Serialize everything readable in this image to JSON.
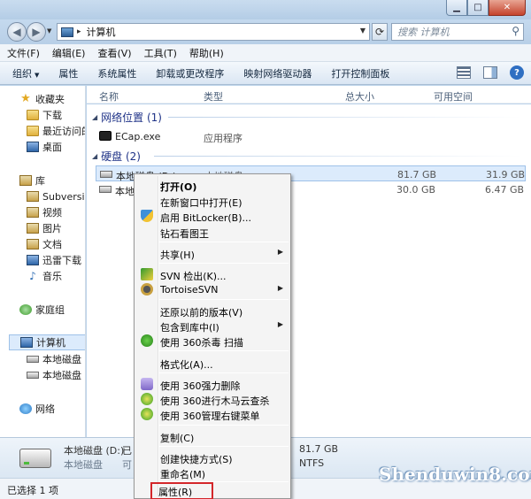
{
  "address": {
    "crumb": "计算机",
    "separator": "▸"
  },
  "search": {
    "placeholder": "搜索 计算机"
  },
  "menubar": [
    "文件(F)",
    "编辑(E)",
    "查看(V)",
    "工具(T)",
    "帮助(H)"
  ],
  "toolbar": {
    "organize": "组织",
    "properties": "属性",
    "system_properties": "系统属性",
    "uninstall": "卸载或更改程序",
    "map_drive": "映射网络驱动器",
    "control_panel": "打开控制面板"
  },
  "nav": {
    "favorites": "收藏夹",
    "downloads": "下载",
    "recent": "最近访问的",
    "desktop": "桌面",
    "libraries": "库",
    "subversion": "Subversion",
    "videos": "视频",
    "pictures": "图片",
    "documents": "文档",
    "thunder": "迅雷下载",
    "music": "音乐",
    "homegroup": "家庭组",
    "computer": "计算机",
    "local_c": "本地磁盘 (C",
    "local_d": "本地磁盘 (D",
    "network": "网络"
  },
  "columns": {
    "name": "名称",
    "type": "类型",
    "total": "总大小",
    "free": "可用空间"
  },
  "groups": {
    "network_location": "网络位置 (1)",
    "hard_disks": "硬盘 (2)"
  },
  "rows": {
    "ecap": {
      "name": "ECap.exe",
      "type": "应用程序"
    },
    "drive_d": {
      "name": "本地磁盘 (D:)",
      "type": "本地磁盘",
      "total": "81.7 GB",
      "free": "31.9 GB"
    },
    "drive_c": {
      "name": "本地磁",
      "total": "30.0 GB",
      "free": "6.47 GB"
    }
  },
  "details": {
    "name": "本地磁盘 (D:)",
    "name_suffix": "已",
    "type": "本地磁盘",
    "avail_label": "可",
    "total": "81.7 GB",
    "fs": "NTFS"
  },
  "status": {
    "selected": "已选择 1 项"
  },
  "context_menu": {
    "open": "打开(O)",
    "open_new_window": "在新窗口中打开(E)",
    "bitlocker": "启用 BitLocker(B)...",
    "diamond": "钻石看图王",
    "share": "共享(H)",
    "svn_checkout": "SVN 检出(K)...",
    "tortoise": "TortoiseSVN",
    "restore": "还原以前的版本(V)",
    "include_library": "包含到库中(I)",
    "scan360": "使用 360杀毒 扫描",
    "format": "格式化(A)...",
    "force_delete": "使用 360强力删除",
    "trojan_cloud": "使用 360进行木马云查杀",
    "manage_menu": "使用 360管理右键菜单",
    "copy": "复制(C)",
    "shortcut": "创建快捷方式(S)",
    "rename": "重命名(M)",
    "properties": "属性(R)"
  },
  "watermark": "Shenduwin8.com"
}
